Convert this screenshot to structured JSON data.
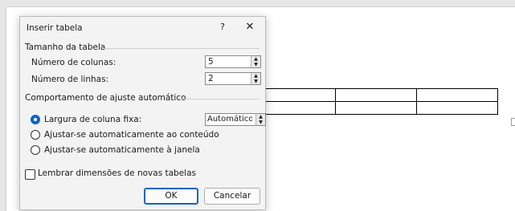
{
  "dialog": {
    "title": "Inserir tabela",
    "help_glyph": "?",
    "close_glyph": "✕"
  },
  "size_section": {
    "label": "Tamanho da tabela",
    "columns_label": "Número de colunas:",
    "columns_value": "5",
    "rows_label": "Número de linhas:",
    "rows_value": "2"
  },
  "autofit_section": {
    "label": "Comportamento de ajuste automático",
    "option_fixed": "Largura de coluna fixa:",
    "fixed_value": "Automático",
    "option_content": "Ajustar-se automaticamente ao conteúdo",
    "option_window": "Ajustar-se automaticamente à janela",
    "selected": "fixed"
  },
  "remember": {
    "label": "Lembrar dimensões de novas tabelas",
    "checked": false
  },
  "buttons": {
    "ok": "OK",
    "cancel": "Cancelar"
  },
  "spinner_arrows": {
    "up": "▲",
    "down": "▼"
  },
  "document": {
    "table_columns": 3,
    "table_rows": 2
  },
  "colors": {
    "accent": "#0a64c8",
    "dialog_bg": "#f3f3f3"
  }
}
